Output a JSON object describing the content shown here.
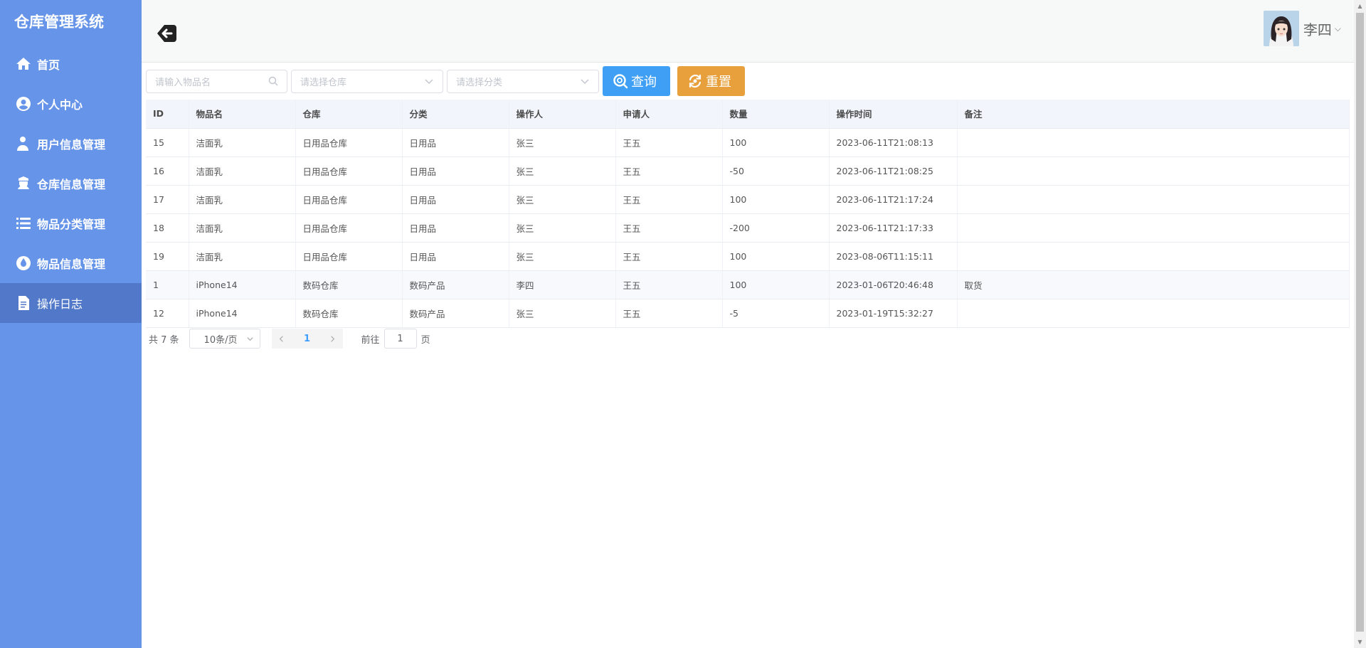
{
  "brand": "仓库管理系统",
  "menu": [
    {
      "label": "首页",
      "icon": "home-icon"
    },
    {
      "label": "个人中心",
      "icon": "user-circle-icon"
    },
    {
      "label": "用户信息管理",
      "icon": "user-add-icon"
    },
    {
      "label": "仓库信息管理",
      "icon": "warehouse-icon"
    },
    {
      "label": "物品分类管理",
      "icon": "list-icon"
    },
    {
      "label": "物品信息管理",
      "icon": "drop-icon"
    },
    {
      "label": "操作日志",
      "icon": "document-icon",
      "active": true
    }
  ],
  "header": {
    "username": "李四",
    "caret": "⌵"
  },
  "search": {
    "item_placeholder": "请输入物品名",
    "warehouse_placeholder": "请选择仓库",
    "category_placeholder": "请选择分类",
    "query_label": "查询",
    "reset_label": "重置"
  },
  "table": {
    "columns": [
      "ID",
      "物品名",
      "仓库",
      "分类",
      "操作人",
      "申请人",
      "数量",
      "操作时间",
      "备注"
    ],
    "rows": [
      [
        "15",
        "洁面乳",
        "日用品仓库",
        "日用品",
        "张三",
        "王五",
        "100",
        "2023-06-11T21:08:13",
        ""
      ],
      [
        "16",
        "洁面乳",
        "日用品仓库",
        "日用品",
        "张三",
        "王五",
        "-50",
        "2023-06-11T21:08:25",
        ""
      ],
      [
        "17",
        "洁面乳",
        "日用品仓库",
        "日用品",
        "张三",
        "王五",
        "100",
        "2023-06-11T21:17:24",
        ""
      ],
      [
        "18",
        "洁面乳",
        "日用品仓库",
        "日用品",
        "张三",
        "王五",
        "-200",
        "2023-06-11T21:17:33",
        ""
      ],
      [
        "19",
        "洁面乳",
        "日用品仓库",
        "日用品",
        "张三",
        "王五",
        "100",
        "2023-08-06T11:15:11",
        ""
      ],
      [
        "1",
        "iPhone14",
        "数码仓库",
        "数码产品",
        "李四",
        "王五",
        "100",
        "2023-01-06T20:46:48",
        "取货"
      ],
      [
        "12",
        "iPhone14",
        "数码仓库",
        "数码产品",
        "张三",
        "王五",
        "-5",
        "2023-01-19T15:32:27",
        ""
      ]
    ]
  },
  "pager": {
    "total": "共 7 条",
    "page_size": "10条/页",
    "current_page": "1",
    "goto_prefix": "前往",
    "goto_value": "1",
    "goto_suffix": "页"
  },
  "colors": {
    "sidebar": "#6694e8",
    "sidebar_active": "#5279c9",
    "query": "#3e9ff5",
    "reset": "#e7a03c",
    "link": "#409eff"
  }
}
